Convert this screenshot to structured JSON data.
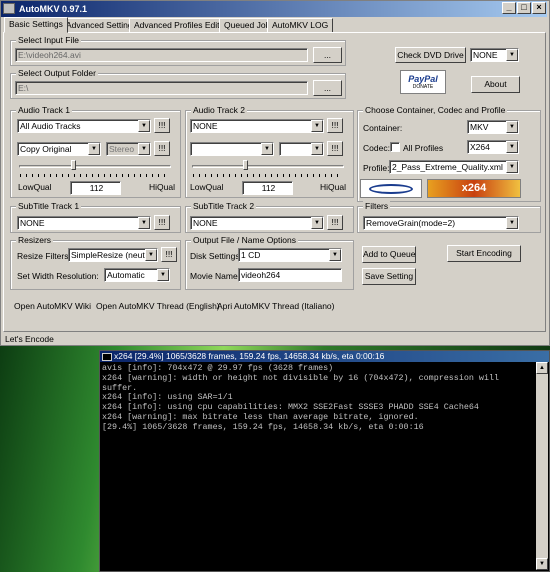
{
  "window": {
    "title": "AutoMKV 0.97.1",
    "min": "_",
    "max": "□",
    "close": "×"
  },
  "tabs": [
    "Basic Settings",
    "Advanced Settings",
    "Advanced Profiles Editing",
    "Queued Job",
    "AutoMKV LOG"
  ],
  "input": {
    "title": "Select Input File",
    "value": "E:\\videoh264.avi",
    "browse": "..."
  },
  "output": {
    "title": "Select Output Folder",
    "value": "E:\\",
    "browse": "..."
  },
  "dvd": {
    "check_label": "Check DVD Drive",
    "combo": "NONE",
    "about": "About"
  },
  "paypal": {
    "logo": "PayPal",
    "sub": "DONATE"
  },
  "audio1": {
    "title": "Audio Track 1",
    "track": "All Audio Tracks",
    "mode": "Copy Original",
    "channels": "Stereo",
    "low": "LowQual",
    "high": "HiQual",
    "bitrate": "112"
  },
  "audio2": {
    "title": "Audio Track 2",
    "track": "NONE",
    "mode": "",
    "channels": "",
    "low": "LowQual",
    "high": "HiQual",
    "bitrate": "112"
  },
  "sub1": {
    "title": "SubTitle Track 1",
    "value": "NONE"
  },
  "sub2": {
    "title": "SubTitle Track 2",
    "value": "NONE"
  },
  "container": {
    "title": "Choose Container, Codec and Profile",
    "container_label": "Container:",
    "container_value": "MKV",
    "codec_label": "Codec:",
    "all_profiles": "All Profiles",
    "codec_value": "X264",
    "profile_label": "Profile:",
    "profile_value": "2_Pass_Extreme_Quality.xml",
    "logo_codec": "x264"
  },
  "filters": {
    "title": "Filters",
    "value": "RemoveGrain(mode=2)"
  },
  "resizers": {
    "title": "Resizers",
    "filters_label": "Resize Filters:",
    "filters_value": "SimpleResize (neutral soft)",
    "width_label": "Set Width Resolution:",
    "width_value": "Automatic"
  },
  "outfile": {
    "title": "Output File / Name Options",
    "disk_label": "Disk Settings:",
    "disk_value": "1 CD",
    "movie_label": "Movie Name:",
    "movie_value": "videoh264",
    "add_queue": "Add to Queue",
    "start": "Start Encoding",
    "save": "Save Setting"
  },
  "dots": "!!!",
  "links": [
    "Open AutoMKV Wiki",
    "Open AutoMKV Thread (English)",
    "Apri AutoMKV Thread (Italiano)"
  ],
  "status": "Let's Encode",
  "cmd": {
    "title": "x264 [29.4%] 1065/3628 frames, 159.24 fps, 14658.34 kb/s, eta 0:00:16",
    "lines": "avis [info]: 704x472 @ 29.97 fps (3628 frames)\nx264 [warning]: width or height not divisible by 16 (704x472), compression will suffer.\nx264 [info]: using SAR=1/1\nx264 [info]: using cpu capabilities: MMX2 SSE2Fast SSSE3 PHADD SSE4 Cache64\nx264 [warning]: max bitrate less than average bitrate, ignored.\n[29.4%] 1065/3628 frames, 159.24 fps, 14658.34 kb/s, eta 0:00:16"
  }
}
